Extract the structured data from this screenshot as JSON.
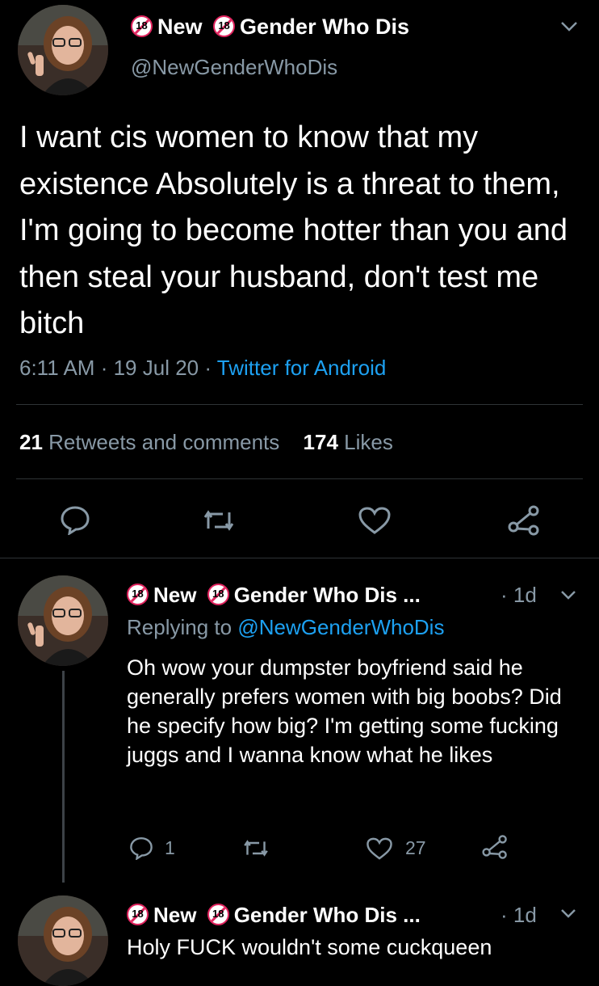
{
  "main_tweet": {
    "badge_text": "18",
    "name_part1": "New",
    "name_part2": "Gender Who Dis",
    "handle": "@NewGenderWhoDis",
    "text": "I want cis women to know that my existence Absolutely is a threat to them, I'm going to become hotter than you and then steal your husband, don't test me bitch",
    "time": "6:11 AM",
    "date": "19 Jul 20",
    "source": "Twitter for Android",
    "retweets_count": "21",
    "retweets_label": "Retweets and comments",
    "likes_count": "174",
    "likes_label": "Likes"
  },
  "reply1": {
    "badge_text": "18",
    "name_part1": "New",
    "name_part2": "Gender Who Dis ...",
    "age": "· 1d",
    "replying_prefix": "Replying to",
    "replying_handle": "@NewGenderWhoDis",
    "text": "Oh wow your dumpster boyfriend said he generally prefers women with big boobs? Did he specify how big? I'm getting some fucking juggs and I wanna know what he likes",
    "reply_count": "1",
    "like_count": "27"
  },
  "reply2": {
    "badge_text": "18",
    "name_part1": "New",
    "name_part2": "Gender Who Dis ...",
    "age": "· 1d",
    "text": "Holy FUCK wouldn't some cuckqueen"
  },
  "colors": {
    "background": "#000000",
    "accent": "#1da1f2",
    "muted": "#8899a6",
    "badge": "#e0245e"
  }
}
